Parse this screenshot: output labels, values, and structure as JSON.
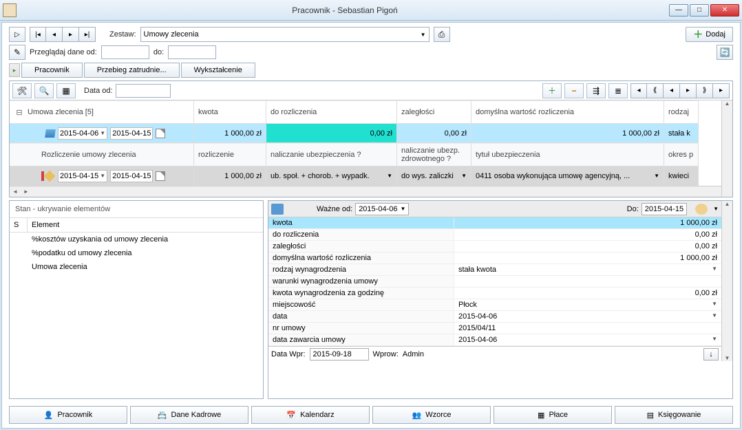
{
  "title": "Pracownik - Sebastian Pigoń",
  "toolbar": {
    "zestaw_label": "Zestaw:",
    "zestaw_value": "Umowy zlecenia",
    "dodaj": "Dodaj",
    "przegladaj": "Przeglądaj dane od:",
    "do": "do:",
    "data_od": "Data od:"
  },
  "tabs": {
    "pracownik": "Pracownik",
    "przebieg": "Przebieg zatrudnie...",
    "wyksztalcenie": "Wykształcenie"
  },
  "grid": {
    "headers1": [
      "Umowa zlecenia [5]",
      "kwota",
      "do rozliczenia",
      "zaległości",
      "domyślna wartość rozliczenia",
      "rodzaj"
    ],
    "row1": {
      "date1": "2015-04-06",
      "date2": "2015-04-15",
      "kwota": "1 000,00 zł",
      "do_rozl": "0,00 zł",
      "zaleg": "0,00 zł",
      "domysl": "1 000,00 zł",
      "rodzaj": "stała k"
    },
    "headers2": [
      "Rozliczenie umowy zlecenia",
      "rozliczenie",
      "naliczanie ubezpieczenia ?",
      "naliczanie ubezp. zdrowotnego ?",
      "tytuł ubezpieczenia",
      "okres p"
    ],
    "row2": {
      "date1": "2015-04-15",
      "date2": "2015-04-15",
      "rozl": "1 000,00 zł",
      "nalicz_ubezp": "ub. społ. + chorob. + wypadk.",
      "nalicz_zdrow": "do wys. zaliczki",
      "tytul": "0411 osoba wykonująca umowę agencyjną, ...",
      "okres": "kwieci"
    }
  },
  "left": {
    "title": "Stan - ukrywanie elementów",
    "col1": "S",
    "col2": "Element",
    "items": [
      "%kosztów uzyskania od umowy zlecenia",
      "%podatku od umowy zlecenia",
      "Umowa zlecenia"
    ]
  },
  "right": {
    "wazne_od_label": "Ważne od:",
    "wazne_od": "2015-04-06",
    "do_label": "Do:",
    "do_val": "2015-04-15",
    "rows": [
      {
        "label": "kwota",
        "val": "1 000,00 zł",
        "num": true,
        "sel": true
      },
      {
        "label": "do rozliczenia",
        "val": "0,00 zł",
        "num": true
      },
      {
        "label": "zaległości",
        "val": "0,00 zł",
        "num": true
      },
      {
        "label": "domyślna wartość rozliczenia",
        "val": "1 000,00 zł",
        "num": true
      },
      {
        "label": "rodzaj wynagrodzenia",
        "val": "stała kwota",
        "dd": true
      },
      {
        "label": "warunki wynagrodzenia umowy",
        "val": ""
      },
      {
        "label": "kwota wynagrodzenia za godzinę",
        "val": "0,00 zł",
        "num": true
      },
      {
        "label": "miejscowość",
        "val": "Płock",
        "dd": true
      },
      {
        "label": "data",
        "val": "2015-04-06",
        "dd": true
      },
      {
        "label": "nr umowy",
        "val": "2015/04/11"
      },
      {
        "label": "data zawarcia umowy",
        "val": "2015-04-06",
        "dd": true
      }
    ],
    "footer": {
      "data_wpr": "Data Wpr:",
      "data_wpr_val": "2015-09-18",
      "wprow": "Wprow:",
      "wprow_val": "Admin"
    }
  },
  "btabs": {
    "pracownik": "Pracownik",
    "dane_kadrowe": "Dane Kadrowe",
    "kalendarz": "Kalendarz",
    "wzorce": "Wzorce",
    "place": "Płace",
    "ksiegowanie": "Księgowanie"
  }
}
